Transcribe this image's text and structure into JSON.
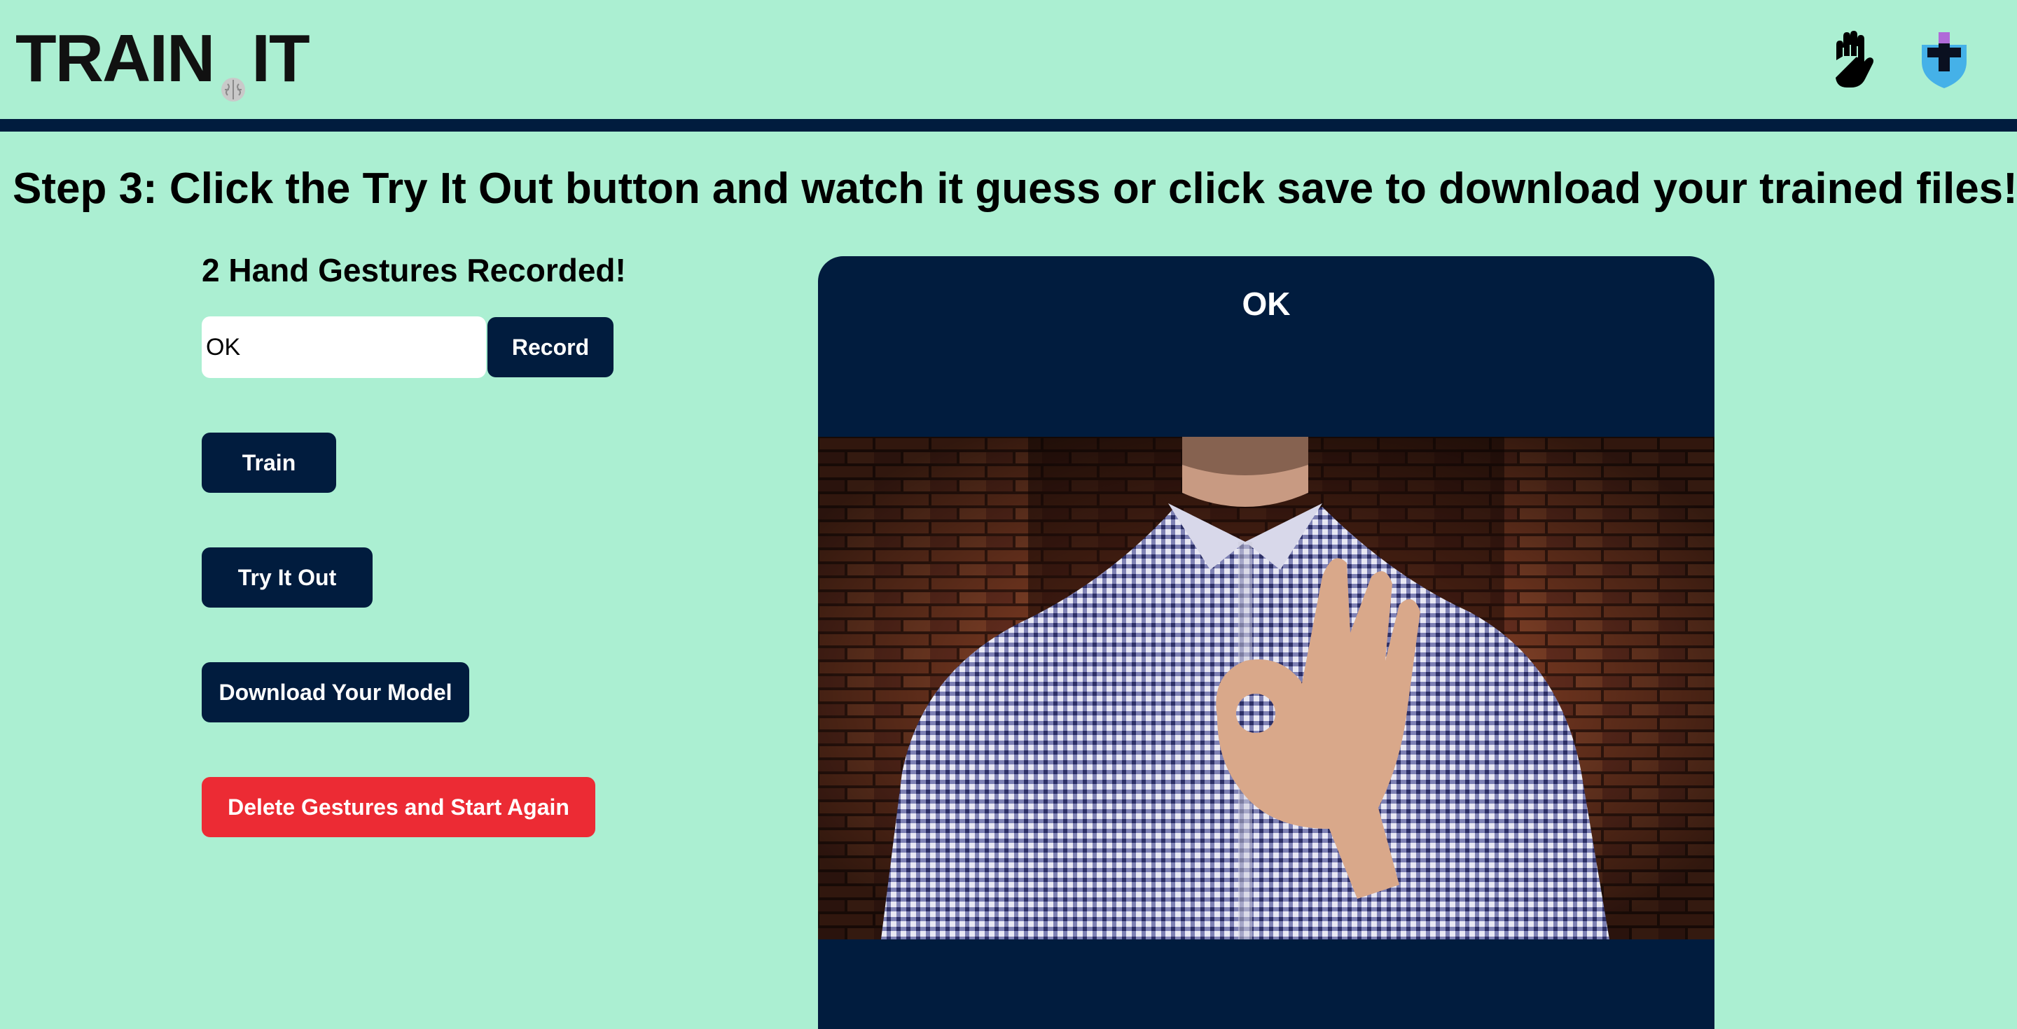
{
  "header": {
    "logo_left": "TRAIN",
    "logo_right": "IT",
    "icons": [
      "brain-icon",
      "hand-icon",
      "shield-plus-icon"
    ]
  },
  "step_title": "Step 3: Click the Try It Out button and watch it guess or click save to download your trained files!",
  "gesture_count": "2 Hand Gestures Recorded!",
  "gesture_input": {
    "value": "OK"
  },
  "buttons": {
    "record": "Record",
    "train": "Train",
    "try_it_out": "Try It Out",
    "download": "Download Your Model",
    "delete": "Delete Gestures and Start Again"
  },
  "prediction": {
    "label": "OK"
  },
  "colors": {
    "background": "#abefd2",
    "navy": "#011c3e",
    "danger": "#ec2b34",
    "white": "#ffffff"
  }
}
